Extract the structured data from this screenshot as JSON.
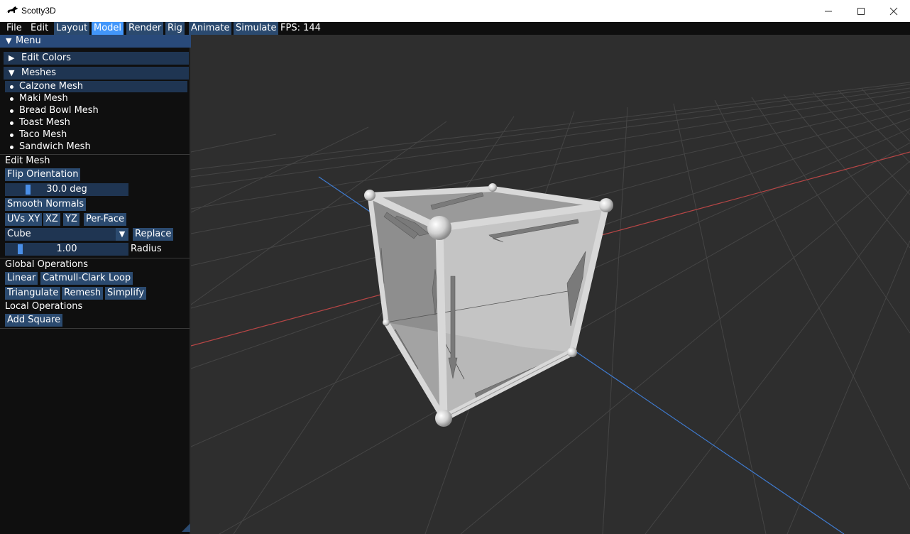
{
  "window": {
    "title": "Scotty3D",
    "minimize_icon": "minimize-icon",
    "maximize_icon": "maximize-icon",
    "close_icon": "close-icon"
  },
  "menubar": {
    "file": "File",
    "edit": "Edit",
    "layout": "Layout",
    "model": "Model",
    "render": "Render",
    "rig": "Rig",
    "animate": "Animate",
    "simulate": "Simulate",
    "fps": "FPS: 144",
    "active_mode": "Model"
  },
  "panel": {
    "header": "Menu",
    "edit_colors": "Edit Colors",
    "meshes_header": "Meshes",
    "meshes": [
      {
        "label": "Calzone Mesh",
        "selected": true
      },
      {
        "label": "Maki Mesh",
        "selected": false
      },
      {
        "label": "Bread Bowl Mesh",
        "selected": false
      },
      {
        "label": "Toast Mesh",
        "selected": false
      },
      {
        "label": "Taco Mesh",
        "selected": false
      },
      {
        "label": "Sandwich Mesh",
        "selected": false
      }
    ],
    "edit_mesh": {
      "title": "Edit Mesh",
      "flip_orientation": "Flip Orientation",
      "angle_value": "30.0 deg",
      "smooth_normals": "Smooth Normals",
      "uv_xy": "UVs XY",
      "uv_xz": "XZ",
      "uv_yz": "YZ",
      "per_face": "Per-Face",
      "shape_selected": "Cube",
      "replace": "Replace",
      "radius_value": "1.00",
      "radius_label": "Radius"
    },
    "global_ops": {
      "title": "Global Operations",
      "linear": "Linear",
      "catmull_clark": "Catmull-Clark",
      "loop": "Loop",
      "triangulate": "Triangulate",
      "remesh": "Remesh",
      "simplify": "Simplify"
    },
    "local_ops": {
      "title": "Local Operations",
      "add_square": "Add Square"
    }
  },
  "viewport": {
    "background": "#2e2e2e",
    "grid_color": "#4a4a4a",
    "x_axis_color": "#c04848",
    "z_axis_color": "#3f7bd0",
    "mesh_face_color": "#bdbdbd",
    "object": "Cube"
  }
}
